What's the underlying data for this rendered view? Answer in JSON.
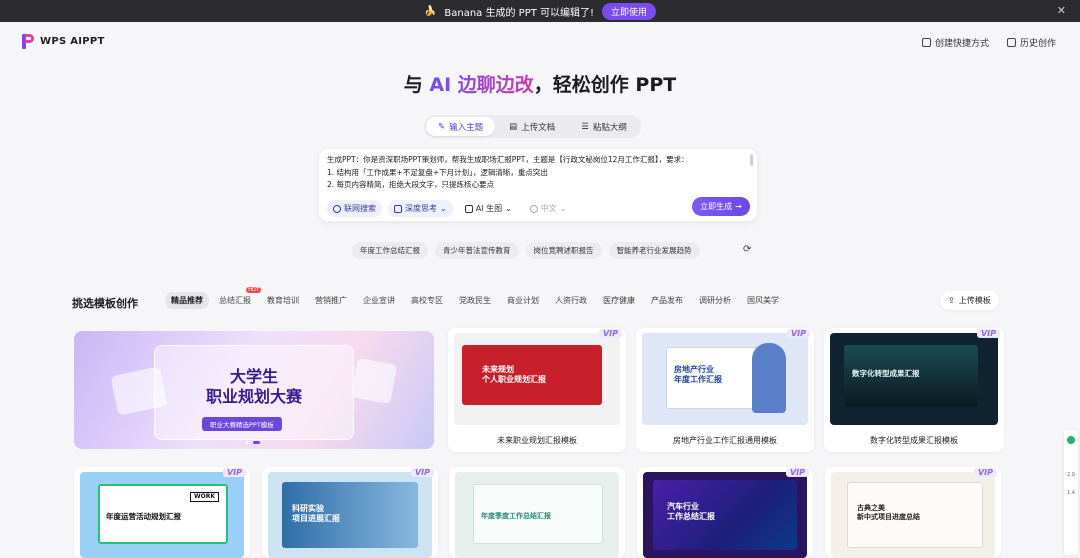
{
  "banner": {
    "text": "Banana 生成的 PPT 可以编辑了!",
    "cta": "立即使用",
    "emoji": "🍌"
  },
  "header": {
    "logo": "WPS AIPPT",
    "links": [
      "创建快捷方式",
      "历史创作"
    ]
  },
  "hero": {
    "pre": "与 ",
    "highlight": "AI 边聊边改",
    "post": "，轻松创作 PPT"
  },
  "mode_tabs": [
    "输入主题",
    "上传文档",
    "粘贴大纲"
  ],
  "prompt": {
    "lines": [
      "生成PPT：你是资深职场PPT策划师，帮我生成职场汇报PPT，主题是【行政文秘岗位12月工作汇报】，要求：",
      "1. 结构用「工作成果+不足复盘+下月计划」，逻辑清晰，重点突出",
      "2. 每页内容精简，拒绝大段文字，只提炼核心要点"
    ],
    "tools": [
      "联网搜索",
      "深度思考",
      "AI 生图",
      "中文"
    ],
    "generate": "立即生成"
  },
  "suggestions": [
    "年度工作总结汇报",
    "青少年普法宣传教育",
    "岗位竞聘述职报告",
    "智能养老行业发展趋势"
  ],
  "section": {
    "title": "挑选模板创作",
    "categories": [
      "精品推荐",
      "总结汇报",
      "教育培训",
      "营销推广",
      "企业宣讲",
      "高校专区",
      "党政民生",
      "商业计划",
      "人资行政",
      "医疗健康",
      "产品发布",
      "调研分析",
      "国风美学"
    ],
    "hot_badge": "HOT",
    "upload": "上传模板"
  },
  "hero_card": {
    "title_line1": "大学生",
    "title_line2": "职业规划大赛",
    "subtitle": "职业大赛精选PPT模板"
  },
  "vip_badge": "VIP",
  "cards_row1": [
    {
      "label": "未来职业规划汇报模板",
      "thumb_title": "未来规划\n个人职业规划汇报",
      "accent": "#c8202a"
    },
    {
      "label": "房地产行业工作汇报通用模板",
      "thumb_title": "房地产行业\n年度工作汇报",
      "accent": "#1e3fa8"
    },
    {
      "label": "数字化转型成果汇报模板",
      "thumb_title": "数字化转型成果汇报",
      "accent": "#123042"
    }
  ],
  "cards_row2": [
    {
      "thumb_title": "年度运营活动规划汇报",
      "tag": "WORK"
    },
    {
      "thumb_title": "科研实验\n项目进展汇报"
    },
    {
      "thumb_title": "年度季度工作总结汇报"
    },
    {
      "thumb_title": "汽车行业\n工作总结汇报"
    },
    {
      "thumb_title": "古典之美\n新中式项目进度总结"
    }
  ],
  "side_bar": [
    "2.0",
    "1.4"
  ]
}
